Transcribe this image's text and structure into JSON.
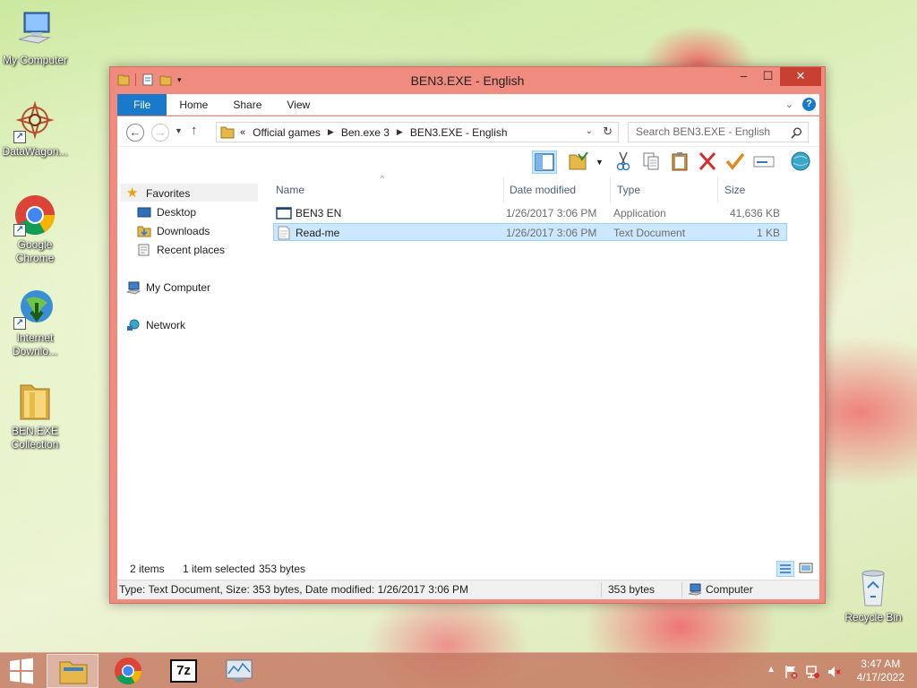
{
  "desktop": {
    "icons": [
      {
        "label": "My Computer"
      },
      {
        "label": "DataWagon..."
      },
      {
        "label": "Google Chrome"
      },
      {
        "label": "Internet Downlo..."
      },
      {
        "label": "BEN.EXE Collection"
      },
      {
        "label": "Recycle Bin"
      }
    ]
  },
  "window": {
    "title": "BEN3.EXE - English",
    "buttons": {
      "minimize": "–",
      "maximize": "☐",
      "close": "✕"
    }
  },
  "ribbon": {
    "tabs": [
      "File",
      "Home",
      "Share",
      "View"
    ]
  },
  "address": {
    "prefix": "«",
    "segments": [
      "Official games",
      "Ben.exe 3",
      "BEN3.EXE - English"
    ],
    "search_placeholder": "Search BEN3.EXE - English"
  },
  "nav": {
    "favorites": "Favorites",
    "items": [
      "Desktop",
      "Downloads",
      "Recent places"
    ],
    "computer": "My Computer",
    "network": "Network"
  },
  "files": {
    "columns": [
      "Name",
      "Date modified",
      "Type",
      "Size"
    ],
    "rows": [
      {
        "name": "BEN3 EN",
        "date": "1/26/2017 3:06 PM",
        "type": "Application",
        "size": "41,636 KB",
        "selected": false
      },
      {
        "name": "Read-me",
        "date": "1/26/2017 3:06 PM",
        "type": "Text Document",
        "size": "1 KB",
        "selected": true
      }
    ]
  },
  "details": {
    "count": "2 items",
    "selection": "1 item selected",
    "bytes": "353 bytes"
  },
  "status": {
    "info": "Type: Text Document, Size: 353 bytes, Date modified: 1/26/2017 3:06 PM",
    "size": "353 bytes",
    "location": "Computer"
  },
  "taskbar": {
    "time": "3:47 AM",
    "date": "4/17/2022",
    "sevenzip": "7z"
  },
  "colors": {
    "accent": "#1979ca",
    "window_frame": "#f08b7f",
    "close": "#c84031",
    "selection": "#cce8ff"
  }
}
